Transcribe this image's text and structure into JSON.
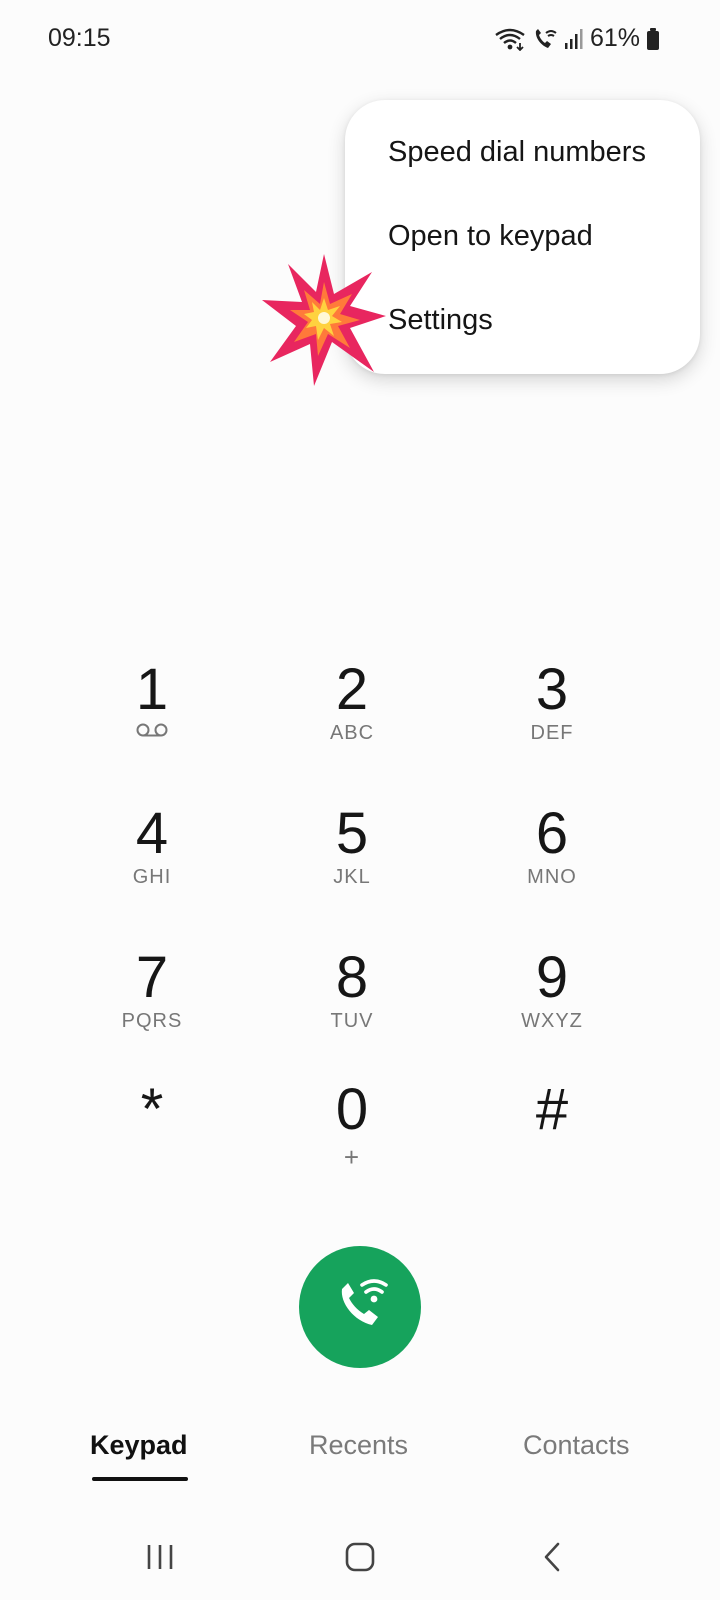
{
  "status_bar": {
    "time": "09:15",
    "battery_percent": "61%",
    "icons": [
      "wifi-icon",
      "wifi-calling-icon",
      "signal-icon",
      "battery-icon"
    ]
  },
  "menu": {
    "items": [
      {
        "label": "Speed dial numbers"
      },
      {
        "label": "Open to keypad"
      },
      {
        "label": "Settings"
      }
    ]
  },
  "keypad": {
    "keys": [
      {
        "digit": "1",
        "letters": "",
        "icon": "voicemail-icon"
      },
      {
        "digit": "2",
        "letters": "ABC"
      },
      {
        "digit": "3",
        "letters": "DEF"
      },
      {
        "digit": "4",
        "letters": "GHI"
      },
      {
        "digit": "5",
        "letters": "JKL"
      },
      {
        "digit": "6",
        "letters": "MNO"
      },
      {
        "digit": "7",
        "letters": "PQRS"
      },
      {
        "digit": "8",
        "letters": "TUV"
      },
      {
        "digit": "9",
        "letters": "WXYZ"
      },
      {
        "digit": "*",
        "letters": ""
      },
      {
        "digit": "0",
        "letters": "+"
      },
      {
        "digit": "#",
        "letters": ""
      }
    ]
  },
  "call_button": {
    "icon": "wifi-call-icon",
    "color": "#16a35c"
  },
  "tabs": [
    {
      "label": "Keypad",
      "active": true
    },
    {
      "label": "Recents",
      "active": false
    },
    {
      "label": "Contacts",
      "active": false
    }
  ],
  "navbar": {
    "icons": [
      "recents-nav-icon",
      "home-nav-icon",
      "back-nav-icon"
    ]
  },
  "colors": {
    "accent_green": "#16a35c",
    "background": "#fcfcfc",
    "burst_red": "#e8265f",
    "burst_yellow": "#ffd23f"
  }
}
